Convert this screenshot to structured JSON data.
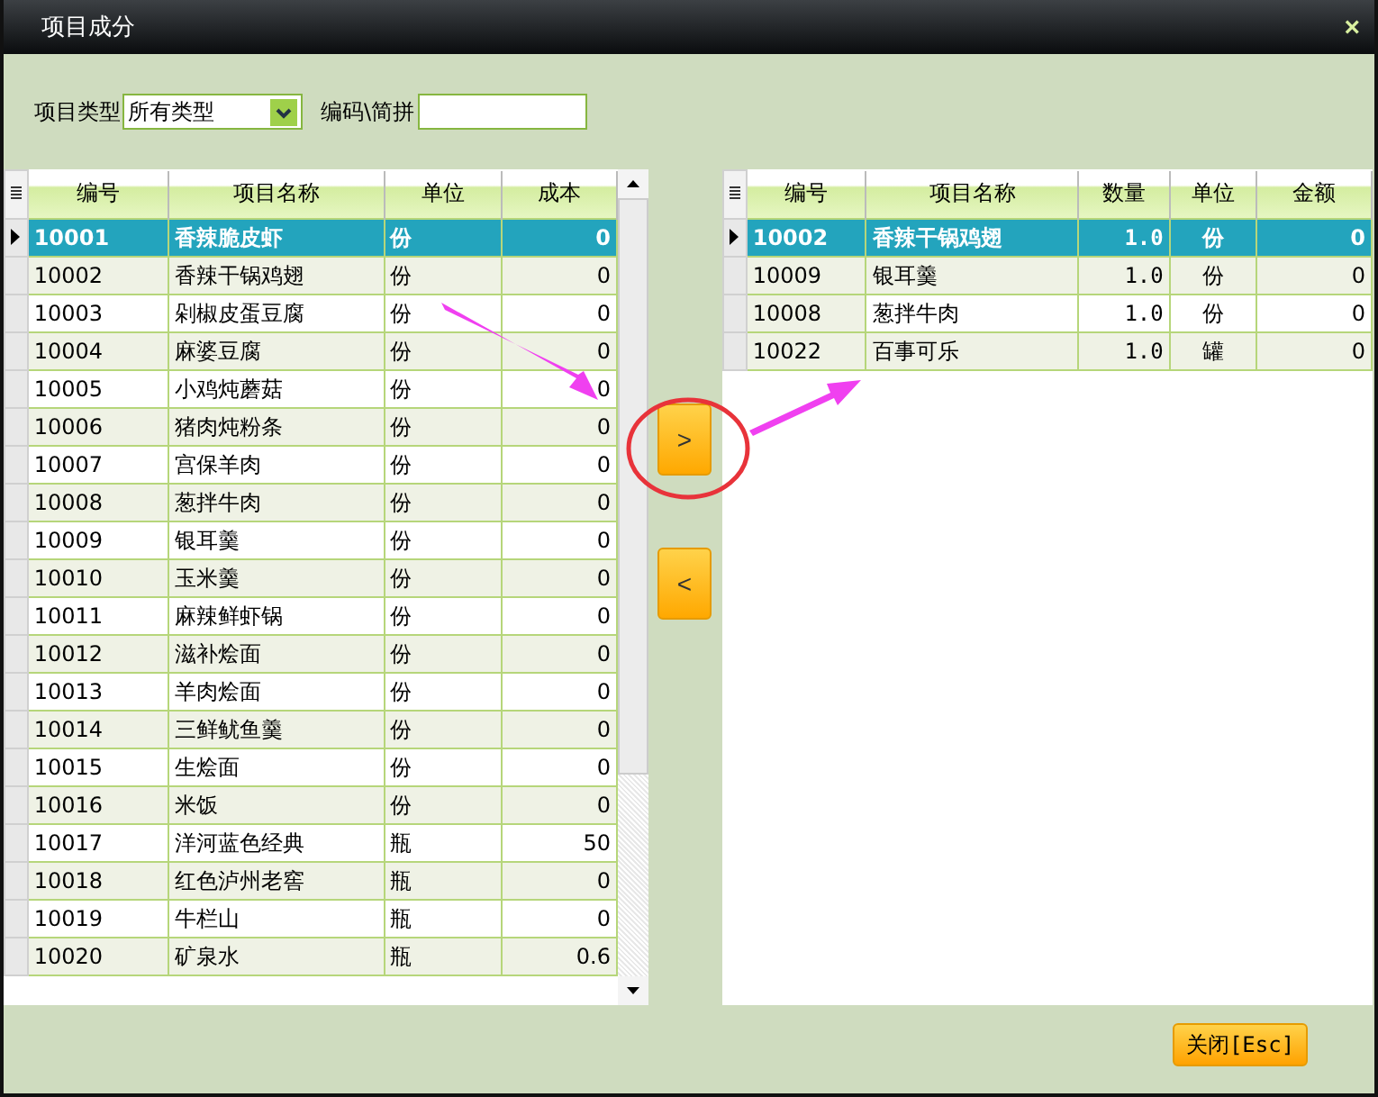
{
  "window": {
    "title": "项目成分",
    "close": "×"
  },
  "filter": {
    "type_label": "项目类型",
    "type_value": "所有类型",
    "code_label": "编码\\简拼"
  },
  "left_table": {
    "columns": [
      "编号",
      "项目名称",
      "单位",
      "成本"
    ],
    "rows": [
      {
        "id": "10001",
        "name": "香辣脆皮虾",
        "unit": "份",
        "cost": "0",
        "selected": true
      },
      {
        "id": "10002",
        "name": "香辣干锅鸡翅",
        "unit": "份",
        "cost": "0",
        "selected": false
      },
      {
        "id": "10003",
        "name": "剁椒皮蛋豆腐",
        "unit": "份",
        "cost": "0",
        "selected": false
      },
      {
        "id": "10004",
        "name": "麻婆豆腐",
        "unit": "份",
        "cost": "0",
        "selected": false
      },
      {
        "id": "10005",
        "name": "小鸡炖蘑菇",
        "unit": "份",
        "cost": "0",
        "selected": false
      },
      {
        "id": "10006",
        "name": "猪肉炖粉条",
        "unit": "份",
        "cost": "0",
        "selected": false
      },
      {
        "id": "10007",
        "name": "宫保羊肉",
        "unit": "份",
        "cost": "0",
        "selected": false
      },
      {
        "id": "10008",
        "name": "葱拌牛肉",
        "unit": "份",
        "cost": "0",
        "selected": false
      },
      {
        "id": "10009",
        "name": "银耳羹",
        "unit": "份",
        "cost": "0",
        "selected": false
      },
      {
        "id": "10010",
        "name": "玉米羹",
        "unit": "份",
        "cost": "0",
        "selected": false
      },
      {
        "id": "10011",
        "name": "麻辣鲜虾锅",
        "unit": "份",
        "cost": "0",
        "selected": false
      },
      {
        "id": "10012",
        "name": "滋补烩面",
        "unit": "份",
        "cost": "0",
        "selected": false
      },
      {
        "id": "10013",
        "name": "羊肉烩面",
        "unit": "份",
        "cost": "0",
        "selected": false
      },
      {
        "id": "10014",
        "name": "三鲜鱿鱼羹",
        "unit": "份",
        "cost": "0",
        "selected": false
      },
      {
        "id": "10015",
        "name": "生烩面",
        "unit": "份",
        "cost": "0",
        "selected": false
      },
      {
        "id": "10016",
        "name": "米饭",
        "unit": "份",
        "cost": "0",
        "selected": false
      },
      {
        "id": "10017",
        "name": "洋河蓝色经典",
        "unit": "瓶",
        "cost": "50",
        "selected": false
      },
      {
        "id": "10018",
        "name": "红色泸州老窖",
        "unit": "瓶",
        "cost": "0",
        "selected": false
      },
      {
        "id": "10019",
        "name": "牛栏山",
        "unit": "瓶",
        "cost": "0",
        "selected": false
      },
      {
        "id": "10020",
        "name": "矿泉水",
        "unit": "瓶",
        "cost": "0.6",
        "selected": false
      }
    ]
  },
  "move_buttons": [
    ">",
    "<"
  ],
  "right_table": {
    "columns": [
      "编号",
      "项目名称",
      "数量",
      "单位",
      "金额"
    ],
    "rows": [
      {
        "id": "10002",
        "name": "香辣干锅鸡翅",
        "qty": "1.0",
        "unit": "份",
        "amount": "0",
        "selected": true
      },
      {
        "id": "10009",
        "name": "银耳羹",
        "qty": "1.0",
        "unit": "份",
        "amount": "0",
        "selected": false
      },
      {
        "id": "10008",
        "name": "葱拌牛肉",
        "qty": "1.0",
        "unit": "份",
        "amount": "0",
        "selected": false
      },
      {
        "id": "10022",
        "name": "百事可乐",
        "qty": "1.0",
        "unit": "罐",
        "amount": "0",
        "selected": false
      }
    ]
  },
  "close_button": "关闭[Esc]"
}
